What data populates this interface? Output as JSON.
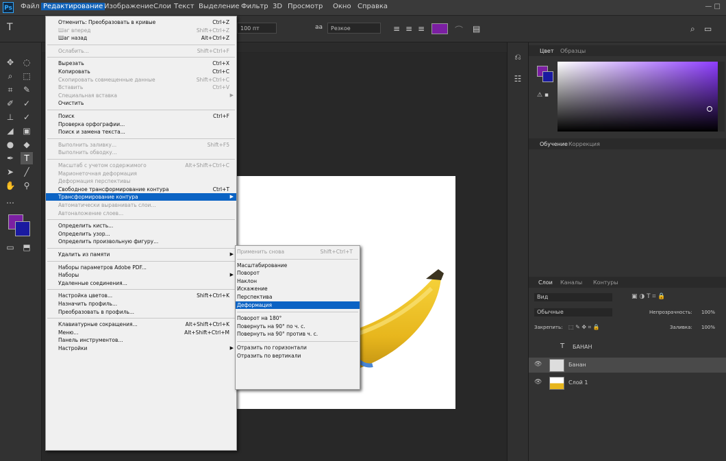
{
  "menubar": {
    "items": [
      "Файл",
      "Редактирование",
      "Изображение",
      "Слои",
      "Текст",
      "Выделение",
      "Фильтр",
      "3D",
      "Просмотр",
      "Окно",
      "Справка"
    ],
    "active_index": 1,
    "window_controls": "—   □"
  },
  "options_bar": {
    "tool_label": "T",
    "font_size": "100 пт",
    "aa_label": "aa",
    "aa_value": "Резкое"
  },
  "edit_menu": {
    "items": [
      {
        "label": "Отменить: Преобразовать в кривые",
        "shortcut": "Ctrl+Z",
        "disabled": false
      },
      {
        "label": "Шаг вперед",
        "shortcut": "Shift+Ctrl+Z",
        "disabled": true
      },
      {
        "label": "Шаг назад",
        "shortcut": "Alt+Ctrl+Z",
        "disabled": false
      },
      {
        "sep": true
      },
      {
        "label": "Ослабить...",
        "shortcut": "Shift+Ctrl+F",
        "disabled": true
      },
      {
        "sep": true
      },
      {
        "label": "Вырезать",
        "shortcut": "Ctrl+X",
        "disabled": false
      },
      {
        "label": "Копировать",
        "shortcut": "Ctrl+C",
        "disabled": false
      },
      {
        "label": "Скопировать совмещенные данные",
        "shortcut": "Shift+Ctrl+C",
        "disabled": true
      },
      {
        "label": "Вставить",
        "shortcut": "Ctrl+V",
        "disabled": true
      },
      {
        "label": "Специальная вставка",
        "shortcut": "",
        "disabled": true,
        "submenu": true
      },
      {
        "label": "Очистить",
        "shortcut": "",
        "disabled": false
      },
      {
        "sep": true
      },
      {
        "label": "Поиск",
        "shortcut": "Ctrl+F",
        "disabled": false
      },
      {
        "label": "Проверка орфографии...",
        "shortcut": "",
        "disabled": false
      },
      {
        "label": "Поиск и замена текста...",
        "shortcut": "",
        "disabled": false
      },
      {
        "sep": true
      },
      {
        "label": "Выполнить заливку...",
        "shortcut": "Shift+F5",
        "disabled": true
      },
      {
        "label": "Выполнить обводку...",
        "shortcut": "",
        "disabled": true
      },
      {
        "sep": true
      },
      {
        "label": "Масштаб с учетом содержимого",
        "shortcut": "Alt+Shift+Ctrl+C",
        "disabled": true
      },
      {
        "label": "Марионеточная деформация",
        "shortcut": "",
        "disabled": true
      },
      {
        "label": "Деформация перспективы",
        "shortcut": "",
        "disabled": true
      },
      {
        "label": "Свободное трансформирование контура",
        "shortcut": "Ctrl+T",
        "disabled": false
      },
      {
        "label": "Трансформирование контура",
        "shortcut": "",
        "disabled": false,
        "submenu": true,
        "highlighted": true
      },
      {
        "label": "Автоматически выравнивать слои...",
        "shortcut": "",
        "disabled": true
      },
      {
        "label": "Автоналожение слоев...",
        "shortcut": "",
        "disabled": true
      },
      {
        "sep": true
      },
      {
        "label": "Определить кисть...",
        "shortcut": "",
        "disabled": false
      },
      {
        "label": "Определить узор...",
        "shortcut": "",
        "disabled": false
      },
      {
        "label": "Определить произвольную фигуру...",
        "shortcut": "",
        "disabled": false
      },
      {
        "sep": true
      },
      {
        "label": "Удалить из памяти",
        "shortcut": "",
        "disabled": false,
        "submenu": true
      },
      {
        "sep": true
      },
      {
        "label": "Наборы параметров Adobe PDF...",
        "shortcut": "",
        "disabled": false
      },
      {
        "label": "Наборы",
        "shortcut": "",
        "disabled": false,
        "submenu": true
      },
      {
        "label": "Удаленные соединения...",
        "shortcut": "",
        "disabled": false
      },
      {
        "sep": true
      },
      {
        "label": "Настройка цветов...",
        "shortcut": "Shift+Ctrl+K",
        "disabled": false
      },
      {
        "label": "Назначить профиль...",
        "shortcut": "",
        "disabled": false
      },
      {
        "label": "Преобразовать в профиль...",
        "shortcut": "",
        "disabled": false
      },
      {
        "sep": true
      },
      {
        "label": "Клавиатурные сокращения...",
        "shortcut": "Alt+Shift+Ctrl+K",
        "disabled": false
      },
      {
        "label": "Меню...",
        "shortcut": "Alt+Shift+Ctrl+M",
        "disabled": false
      },
      {
        "label": "Панель инструментов...",
        "shortcut": "",
        "disabled": false
      },
      {
        "label": "Настройки",
        "shortcut": "",
        "disabled": false,
        "submenu": true
      }
    ]
  },
  "transform_submenu": {
    "items": [
      {
        "label": "Применить снова",
        "shortcut": "Shift+Ctrl+T",
        "disabled": true
      },
      {
        "sep": true
      },
      {
        "label": "Масштабирование"
      },
      {
        "label": "Поворот"
      },
      {
        "label": "Наклон"
      },
      {
        "label": "Искажение"
      },
      {
        "label": "Перспектива"
      },
      {
        "label": "Деформация",
        "highlighted": true
      },
      {
        "sep": true
      },
      {
        "label": "Поворот на 180°"
      },
      {
        "label": "Повернуть на 90° по ч. с."
      },
      {
        "label": "Повернуть на 90° против ч. с."
      },
      {
        "sep": true
      },
      {
        "label": "Отразить по горизонтали"
      },
      {
        "label": "Отразить по вертикали"
      }
    ]
  },
  "right_panel": {
    "color_tabs": [
      "Цвет",
      "Образцы"
    ],
    "props_tabs": [
      "Обучение",
      "Коррекция"
    ],
    "layers_tabs": [
      "Слои",
      "Каналы",
      "Контуры"
    ],
    "filter_label": "Вид",
    "blend_mode": "Обычные",
    "opacity_label": "Непрозрачность:",
    "opacity_value": "100%",
    "lock_label": "Закрепить:",
    "fill_label": "Заливка:",
    "fill_value": "100%",
    "layers": [
      {
        "name": "БАНАН",
        "type": "text"
      },
      {
        "name": "Банан",
        "type": "smart"
      },
      {
        "name": "Слой 1",
        "type": "image"
      }
    ]
  },
  "colors": {
    "foreground": "#7b1fa2",
    "background": "#1a1aa0",
    "highlight": "#0b63c4"
  }
}
